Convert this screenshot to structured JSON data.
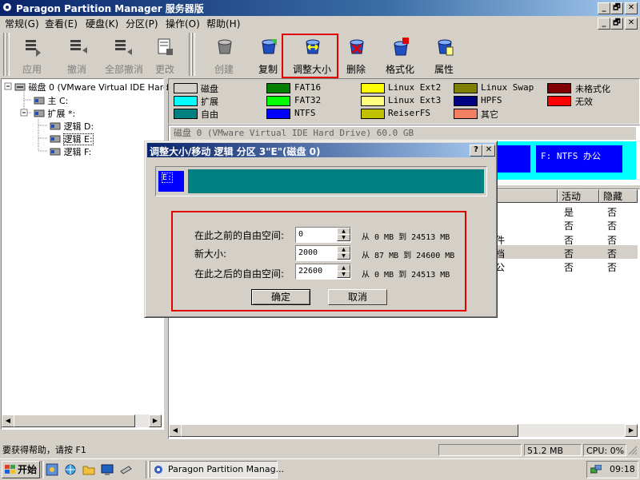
{
  "app": {
    "title": "Paragon Partition Manager 服务器版",
    "caption_min": "_",
    "caption_max": "🗗",
    "caption_close": "✕"
  },
  "menu": [
    "常规(G)",
    "查看(E)",
    "硬盘(K)",
    "分区(P)",
    "操作(O)",
    "帮助(H)"
  ],
  "menu_ctrl": {
    "min": "_",
    "max": "🗗",
    "close": "✕"
  },
  "toolbar": {
    "apply": "应用",
    "undo": "撤消",
    "undo_all": "全部撤消",
    "change": "更改",
    "create": "创建",
    "copy": "复制",
    "resize": "调整大小",
    "delete": "删除",
    "format": "格式化",
    "properties": "属性"
  },
  "tree": {
    "disk": "磁盘 0 (VMware Virtual IDE Hard",
    "primary": "主 C:",
    "extended": "扩展 *:",
    "logical_d": "逻辑 D:",
    "logical_e": "逻辑 E:",
    "logical_f": "逻辑 F:"
  },
  "legend": [
    {
      "label": "磁盘",
      "color": "#d4d0c8"
    },
    {
      "label": "FAT16",
      "color": "#008000"
    },
    {
      "label": "Linux Ext2",
      "color": "#ffff00"
    },
    {
      "label": "Linux Swap",
      "color": "#808000"
    },
    {
      "label": "未格式化",
      "color": "#800000"
    },
    {
      "label": "扩展",
      "color": "#00ffff"
    },
    {
      "label": "FAT32",
      "color": "#00ff00"
    },
    {
      "label": "Linux Ext3",
      "color": "#ffff80"
    },
    {
      "label": "HPFS",
      "color": "#000080"
    },
    {
      "label": "无效",
      "color": "#ff0000"
    },
    {
      "label": "自由",
      "color": "#008080"
    },
    {
      "label": "NTFS",
      "color": "#0000ff"
    },
    {
      "label": "ReiserFS",
      "color": "#c0c000"
    },
    {
      "label": "其它",
      "color": "#f08060"
    }
  ],
  "disk_map": {
    "header": "磁盘 0 (VMware Virtual IDE Hard Drive) 60.0 GB",
    "partition_f": "F: NTFS 办公"
  },
  "table": {
    "col_label_fragment": "际",
    "col_active": "活动",
    "col_hidden": "隐藏",
    "rows": [
      {
        "label": "",
        "active": "是",
        "hidden": "否"
      },
      {
        "label": "",
        "active": "否",
        "hidden": "否"
      },
      {
        "label": "件",
        "active": "否",
        "hidden": "否"
      },
      {
        "label": "档",
        "active": "否",
        "hidden": "否"
      },
      {
        "label": "公",
        "active": "否",
        "hidden": "否"
      }
    ]
  },
  "dialog": {
    "title": "调整大小/移动 逻辑 分区 3\"E\"(磁盘 0)",
    "help": "?",
    "close": "✕",
    "partition_label": "E:",
    "fields": [
      {
        "label": "在此之前的自由空间:",
        "value": "0",
        "range": "从 0 MB 到 24513 MB"
      },
      {
        "label": "新大小:",
        "value": "2000",
        "range": "从 87 MB 到 24600 MB"
      },
      {
        "label": "在此之后的自由空间:",
        "value": "22600",
        "range": "从 0 MB 到 24513 MB"
      }
    ],
    "ok": "确定",
    "cancel": "取消"
  },
  "status": {
    "help_text": "要获得帮助，请按 F1",
    "memory": "51.2 MB",
    "cpu": "CPU: 0%"
  },
  "taskbar": {
    "start": "开始",
    "task": "Paragon Partition Manag...",
    "time": "09:18"
  }
}
